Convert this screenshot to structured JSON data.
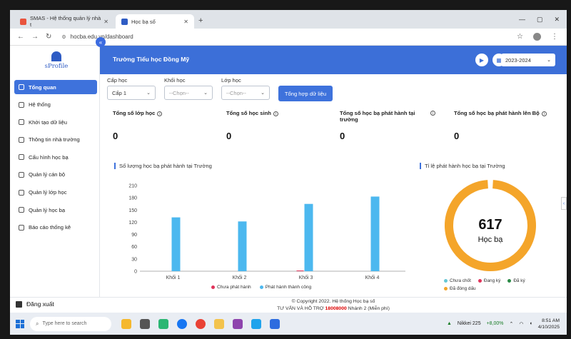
{
  "browser": {
    "tabs": [
      {
        "label": "SMAS - Hệ thống quản lý nhà t",
        "active": false
      },
      {
        "label": "Học bạ số",
        "active": true
      }
    ],
    "url": "hocba.edu.vn/dashboard"
  },
  "app": {
    "logo_text": "sProfile",
    "school_name": "Trường Tiểu học Đồng Mỹ",
    "school_year": "2023-2024",
    "menu": [
      {
        "label": "Tổng quan",
        "active": true,
        "icon": "dashboard-icon"
      },
      {
        "label": "Hệ thống",
        "active": false,
        "icon": "system-icon"
      },
      {
        "label": "Khởi tạo dữ liệu",
        "active": false,
        "icon": "data-init-icon"
      },
      {
        "label": "Thông tin nhà trường",
        "active": false,
        "icon": "school-info-icon"
      },
      {
        "label": "Cấu hình học bạ",
        "active": false,
        "icon": "config-icon"
      },
      {
        "label": "Quản lý cán bộ",
        "active": false,
        "icon": "staff-icon"
      },
      {
        "label": "Quản lý lớp học",
        "active": false,
        "icon": "class-icon"
      },
      {
        "label": "Quản lý học bạ",
        "active": false,
        "icon": "record-icon"
      },
      {
        "label": "Báo cáo thống kê",
        "active": false,
        "icon": "report-icon"
      }
    ],
    "logout_label": "Đăng xuất"
  },
  "filters": {
    "cap_hoc_label": "Cấp học",
    "cap_hoc_value": "Cấp 1",
    "khoi_hoc_label": "Khối học",
    "khoi_hoc_placeholder": "--Chọn--",
    "lop_hoc_label": "Lớp học",
    "lop_hoc_placeholder": "--Chọn--",
    "summary_button": "Tổng hợp dữ liệu"
  },
  "stats": [
    {
      "label": "Tổng số lớp học",
      "value": "0"
    },
    {
      "label": "Tổng số học sinh",
      "value": "0"
    },
    {
      "label": "Tổng số học bạ phát hành tại trường",
      "value": "0"
    },
    {
      "label": "Tổng số học bạ phát hành lên Bộ",
      "value": "0"
    }
  ],
  "bar_chart_title": "Số lượng học bạ phát hành tại Trường",
  "donut_chart_title": "Tỉ lệ phát hành học bạ tại Trường",
  "chart_data": [
    {
      "type": "bar",
      "title": "Số lượng học bạ phát hành tại Trường",
      "categories": [
        "Khối 1",
        "Khối 2",
        "Khối 3",
        "Khối 4"
      ],
      "series": [
        {
          "name": "Chưa phát hành",
          "color": "#e0335a",
          "values": [
            0,
            0,
            1,
            0
          ]
        },
        {
          "name": "Phát hành thành công",
          "color": "#4cb8ef",
          "values": [
            132,
            122,
            165,
            183
          ]
        }
      ],
      "ylim": [
        0,
        210
      ],
      "yticks": [
        0,
        30,
        60,
        90,
        120,
        150,
        180,
        210
      ],
      "legend": "bottom"
    },
    {
      "type": "pie",
      "title": "Tỉ lệ phát hành học bạ tại Trường",
      "center_value": "617",
      "center_label": "Học bạ",
      "slices": [
        {
          "name": "Chưa chốt",
          "color": "#66c7d6",
          "value": 0
        },
        {
          "name": "Đang ký",
          "color": "#e0335a",
          "value": 0
        },
        {
          "name": "Đã ký",
          "color": "#2a8a45",
          "value": 0
        },
        {
          "name": "Đã đóng dấu",
          "color": "#f4a52a",
          "value": 617
        }
      ],
      "legend": "bottom"
    }
  ],
  "footer": {
    "copyright": "© Copyright 2022. Hệ thống Học bạ số",
    "support_prefix": "TƯ VẤN VÀ HỖ TRỢ",
    "support_number": "18008000",
    "support_suffix": "Nhánh 2 (Miễn phí)"
  },
  "taskbar": {
    "search_placeholder": "Type here to search",
    "ticker_name": "Nikkei 225",
    "ticker_value": "+8,00%",
    "time": "8:51 AM",
    "date": "4/10/2025"
  }
}
